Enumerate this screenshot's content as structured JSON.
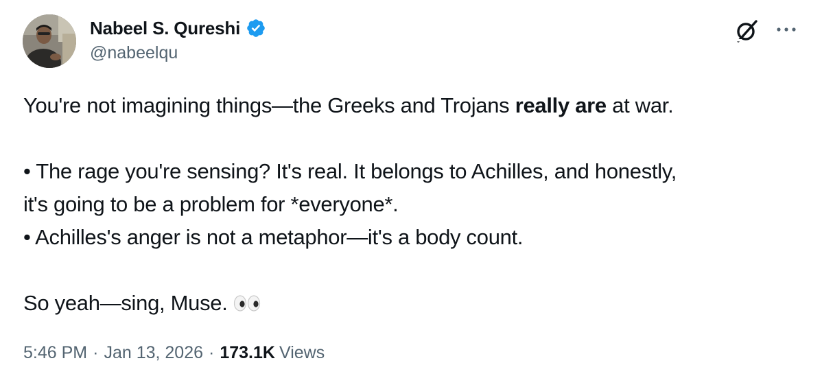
{
  "author": {
    "display_name": "Nabeel S. Qureshi",
    "handle": "@nabeelqu",
    "verified_color": "#1d9bf0"
  },
  "tweet": {
    "line1_before": "You're not imagining things—the Greeks and Trojans ",
    "line1_bold": "really are",
    "line1_after": " at war.",
    "bullet1_line1": "• The rage you're sensing? It's real. It belongs to Achilles, and honestly,",
    "bullet1_line2": "it's going to be a problem for *everyone*.",
    "bullet2": "• Achilles's anger is not a metaphor—it's a body count.",
    "closing": "So yeah—sing, Muse.",
    "emoji": "eyes-emoji"
  },
  "meta": {
    "time": "5:46 PM",
    "separator": "·",
    "date": "Jan 13, 2026",
    "views_count": "173.1K",
    "views_label": "Views"
  },
  "icons": {
    "grok": "grok-icon",
    "more": "more-icon",
    "verified": "verified-badge-icon"
  },
  "colors": {
    "text_primary": "#0f1419",
    "text_secondary": "#536471",
    "accent": "#1d9bf0"
  }
}
